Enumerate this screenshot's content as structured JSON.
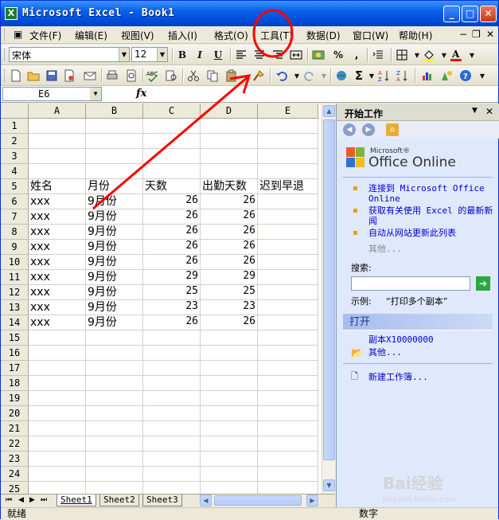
{
  "window": {
    "title": "Microsoft Excel - Book1",
    "minimize": "_",
    "maximize": "□",
    "close": "✕"
  },
  "menu": {
    "items": [
      {
        "label": "文件(F)"
      },
      {
        "label": "编辑(E)"
      },
      {
        "label": "视图(V)"
      },
      {
        "label": "插入(I)"
      },
      {
        "label": "格式(O)"
      },
      {
        "label": "工具(T)"
      },
      {
        "label": "数据(D)"
      },
      {
        "label": "窗口(W)"
      },
      {
        "label": "帮助(H)"
      }
    ],
    "doc_controls": {
      "minimize": "−",
      "restore": "❐",
      "close": "✕"
    }
  },
  "format_toolbar": {
    "font": "宋体",
    "size": "12",
    "bold": "B",
    "italic": "I",
    "underline": "U",
    "percent": "%",
    "comma": ","
  },
  "namebox": {
    "value": "E6",
    "fx": "fx"
  },
  "columns": [
    "A",
    "B",
    "C",
    "D",
    "E"
  ],
  "rows": [
    {
      "num": "1",
      "cells": [
        "",
        "",
        "",
        "",
        ""
      ]
    },
    {
      "num": "2",
      "cells": [
        "",
        "",
        "",
        "",
        ""
      ]
    },
    {
      "num": "3",
      "cells": [
        "",
        "",
        "",
        "",
        ""
      ]
    },
    {
      "num": "4",
      "cells": [
        "",
        "",
        "",
        "",
        ""
      ]
    },
    {
      "num": "5",
      "cells": [
        "姓名",
        "月份",
        "天数",
        "出勤天数",
        "迟到早退"
      ]
    },
    {
      "num": "6",
      "cells": [
        "xxx",
        "9月份",
        "26",
        "26",
        ""
      ]
    },
    {
      "num": "7",
      "cells": [
        "xxx",
        "9月份",
        "26",
        "26",
        ""
      ]
    },
    {
      "num": "8",
      "cells": [
        "xxx",
        "9月份",
        "26",
        "26",
        ""
      ]
    },
    {
      "num": "9",
      "cells": [
        "xxx",
        "9月份",
        "26",
        "26",
        ""
      ]
    },
    {
      "num": "10",
      "cells": [
        "xxx",
        "9月份",
        "26",
        "26",
        ""
      ]
    },
    {
      "num": "11",
      "cells": [
        "xxx",
        "9月份",
        "29",
        "29",
        ""
      ]
    },
    {
      "num": "12",
      "cells": [
        "xxx",
        "9月份",
        "25",
        "25",
        ""
      ]
    },
    {
      "num": "13",
      "cells": [
        "xxx",
        "9月份",
        "23",
        "23",
        ""
      ]
    },
    {
      "num": "14",
      "cells": [
        "xxx",
        "9月份",
        "26",
        "26",
        ""
      ]
    },
    {
      "num": "15",
      "cells": [
        "",
        "",
        "",
        "",
        ""
      ]
    },
    {
      "num": "16",
      "cells": [
        "",
        "",
        "",
        "",
        ""
      ]
    },
    {
      "num": "17",
      "cells": [
        "",
        "",
        "",
        "",
        ""
      ]
    },
    {
      "num": "18",
      "cells": [
        "",
        "",
        "",
        "",
        ""
      ]
    },
    {
      "num": "19",
      "cells": [
        "",
        "",
        "",
        "",
        ""
      ]
    },
    {
      "num": "20",
      "cells": [
        "",
        "",
        "",
        "",
        ""
      ]
    },
    {
      "num": "21",
      "cells": [
        "",
        "",
        "",
        "",
        ""
      ]
    },
    {
      "num": "22",
      "cells": [
        "",
        "",
        "",
        "",
        ""
      ]
    },
    {
      "num": "23",
      "cells": [
        "",
        "",
        "",
        "",
        ""
      ]
    },
    {
      "num": "24",
      "cells": [
        "",
        "",
        "",
        "",
        ""
      ]
    },
    {
      "num": "25",
      "cells": [
        "",
        "",
        "",
        "",
        ""
      ]
    }
  ],
  "sheets": [
    "Sheet1",
    "Sheet2",
    "Sheet3"
  ],
  "status": {
    "left": "就绪",
    "right": "数字"
  },
  "taskpane": {
    "title": "开始工作",
    "logo_small": "Microsoft®",
    "logo_big": "Office Online",
    "links": [
      "连接到 Microsoft Office Online",
      "获取有关使用 Excel 的最新新闻",
      "自动从网站更新此列表"
    ],
    "more": "其他...",
    "search_label": "搜索:",
    "search_value": "",
    "example_label": "示例:",
    "example_text": "“打印多个副本”",
    "open_header": "打开",
    "open_file": "副本X10000000",
    "open_more": "其他...",
    "new_workbook": "新建工作簿..."
  },
  "watermark": "Bai经验",
  "watermark_sub": "jingyan.baidu.com",
  "colors": {
    "title_blue": "#0a5fe8",
    "annotation_red": "#ff0000",
    "link_blue": "#0000cc"
  }
}
